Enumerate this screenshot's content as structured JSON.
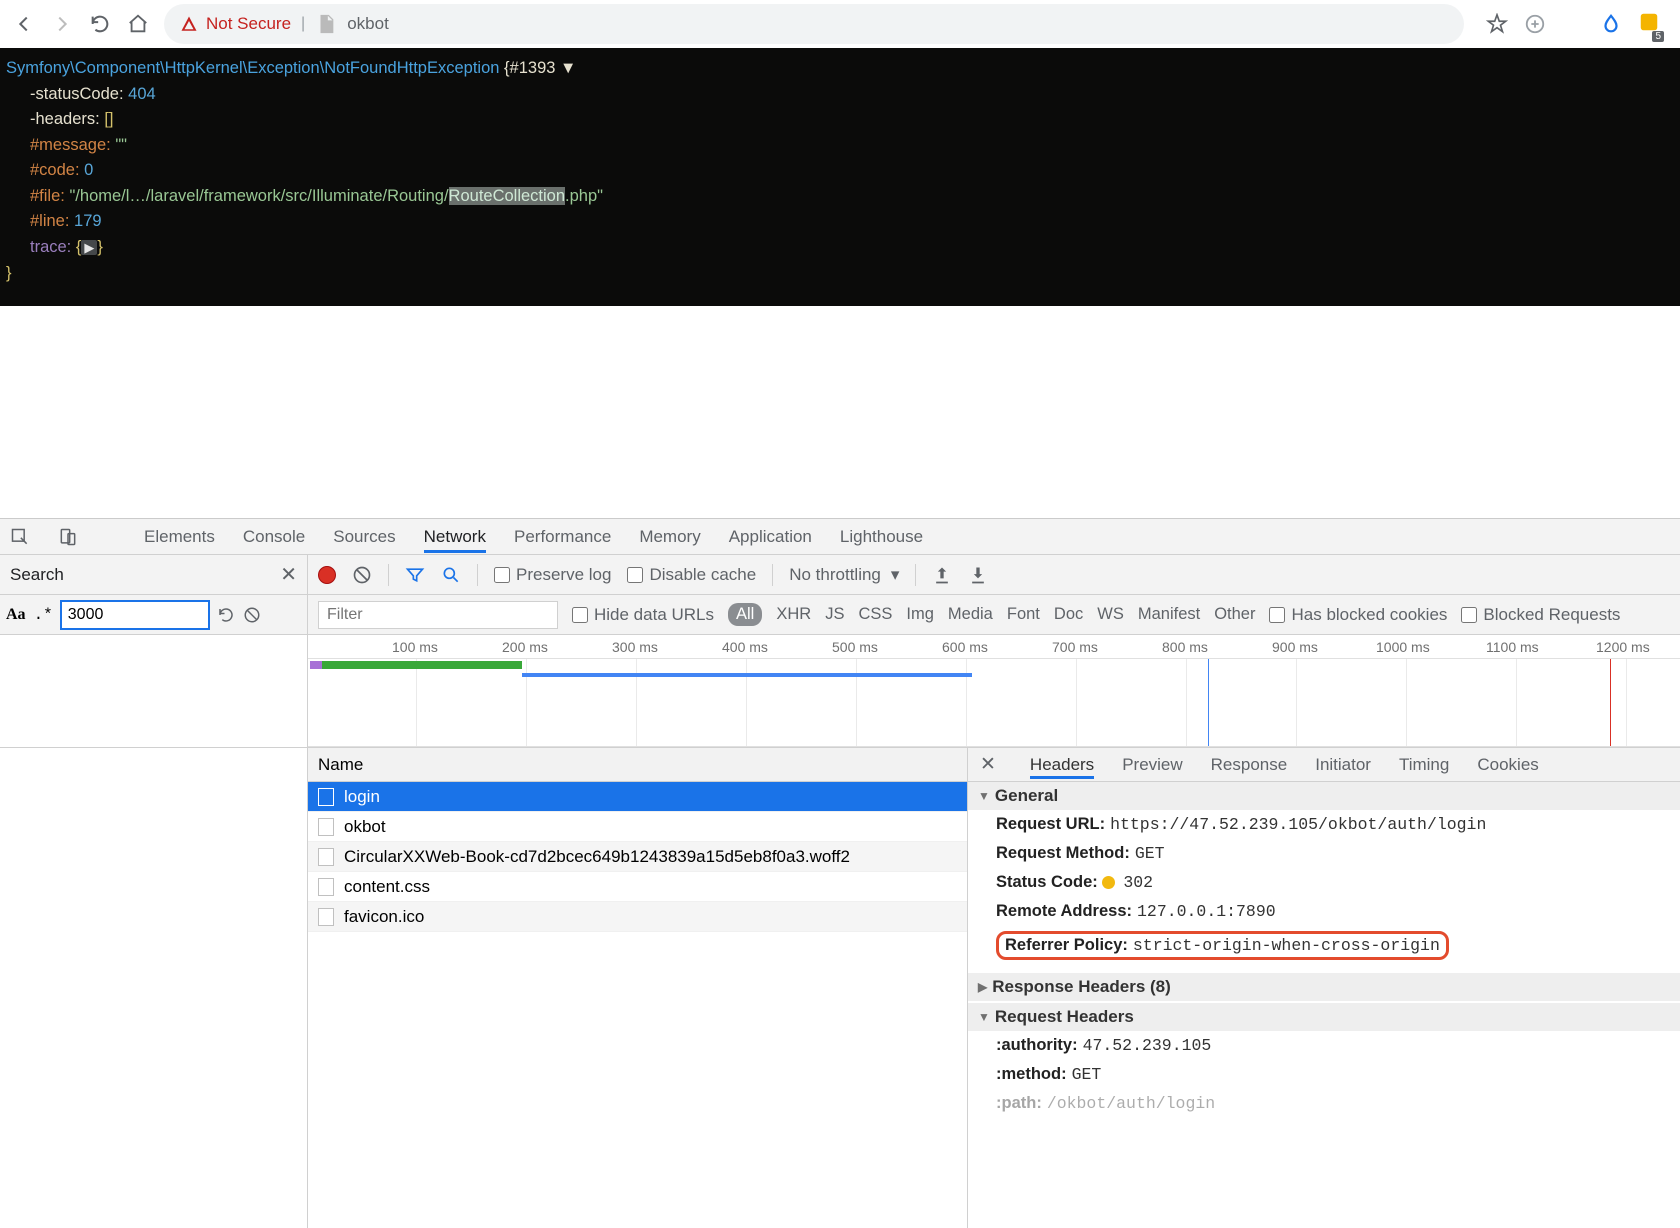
{
  "browser": {
    "not_secure": "Not Secure",
    "url_fragment": "okbot",
    "badge": "5"
  },
  "error": {
    "class": "Symfony\\Component\\HttpKernel\\Exception\\NotFoundHttpException",
    "id": "#1393",
    "statusCodeKey": "-statusCode:",
    "statusCode": "404",
    "headersKey": "-headers:",
    "headers": "[]",
    "messageKey": "#message:",
    "message": "\"\"",
    "codeKey": "#code:",
    "code": "0",
    "fileKey": "#file:",
    "filePath1": "\"/home/l…/laravel/framework/",
    "filePath2": "src/Illuminate/Routing/",
    "filePathHl": "RouteCollection",
    "filePath3": ".php\"",
    "lineKey": "#line:",
    "line": "179",
    "traceKey": "trace:",
    "trace": "{▶}"
  },
  "devtools": {
    "tabs": [
      "Elements",
      "Console",
      "Sources",
      "Network",
      "Performance",
      "Memory",
      "Application",
      "Lighthouse"
    ],
    "activeTab": "Network",
    "search": "Search",
    "searchValue": "3000",
    "preserveLog": "Preserve log",
    "disableCache": "Disable cache",
    "noThrottling": "No throttling",
    "filter": "Filter",
    "hideDataUrls": "Hide data URLs",
    "filterTypes": [
      "All",
      "XHR",
      "JS",
      "CSS",
      "Img",
      "Media",
      "Font",
      "Doc",
      "WS",
      "Manifest",
      "Other"
    ],
    "hasBlockedCookies": "Has blocked cookies",
    "blockedRequests": "Blocked Requests",
    "timelineTicks": [
      "100 ms",
      "200 ms",
      "300 ms",
      "400 ms",
      "500 ms",
      "600 ms",
      "700 ms",
      "800 ms",
      "900 ms",
      "1000 ms",
      "1100 ms",
      "1200 ms"
    ],
    "nameHdr": "Name",
    "requests": [
      "login",
      "okbot",
      "CircularXXWeb-Book-cd7d2bcec649b1243839a15d5eb8f0a3.woff2",
      "content.css",
      "favicon.ico"
    ],
    "detailTabs": [
      "Headers",
      "Preview",
      "Response",
      "Initiator",
      "Timing",
      "Cookies"
    ],
    "general": "General",
    "reqUrlK": "Request URL:",
    "reqUrlV": "https://47.52.239.105/okbot/auth/login",
    "reqMethodK": "Request Method:",
    "reqMethodV": "GET",
    "statusCodeK": "Status Code:",
    "statusCodeV": "302",
    "remoteAddrK": "Remote Address:",
    "remoteAddrV": "127.0.0.1:7890",
    "refPolicyK": "Referrer Policy:",
    "refPolicyV": "strict-origin-when-cross-origin",
    "respHdr": "Response Headers (8)",
    "reqHdr": "Request Headers",
    "authorityK": ":authority:",
    "authorityV": "47.52.239.105",
    "methodK": ":method:",
    "methodV": "GET",
    "pathK": ":path:",
    "pathV": "/okbot/auth/login"
  }
}
